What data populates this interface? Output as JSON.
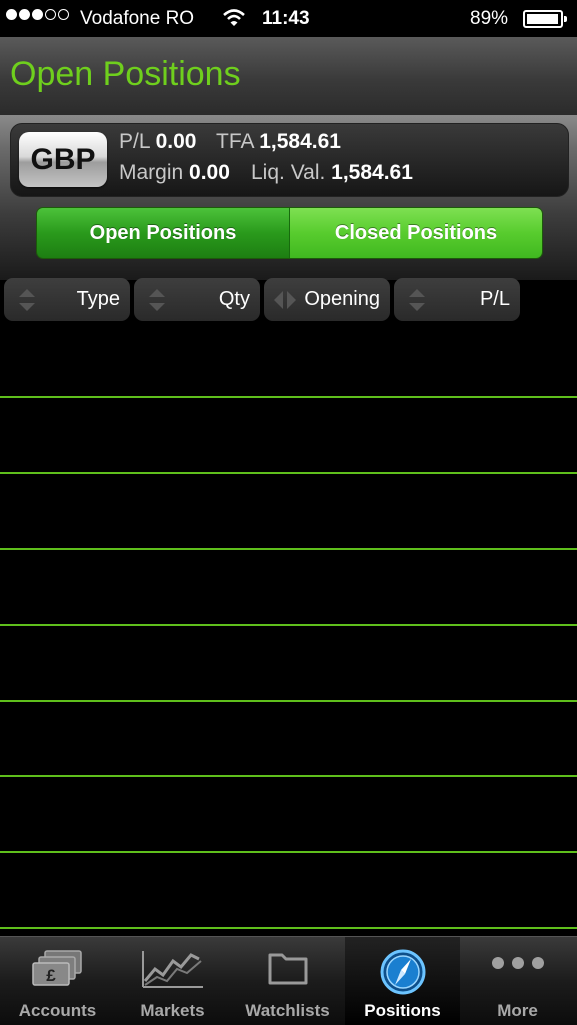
{
  "status_bar": {
    "carrier": "Vodafone RO",
    "time": "11:43",
    "battery": "89%",
    "signal_bars_filled": 3,
    "signal_bars_total": 5
  },
  "header": {
    "title": "Open Positions"
  },
  "account": {
    "currency": "GBP",
    "pl_label": "P/L",
    "pl_value": "0.00",
    "tfa_label": "TFA",
    "tfa_value": "1,584.61",
    "margin_label": "Margin",
    "margin_value": "0.00",
    "liq_label": "Liq. Val.",
    "liq_value": "1,584.61"
  },
  "segmented": {
    "open": "Open Positions",
    "closed": "Closed Positions"
  },
  "columns": [
    "Type",
    "Qty",
    "Opening",
    "P/L"
  ],
  "tab_bar": {
    "items": [
      "Accounts",
      "Markets",
      "Watchlists",
      "Positions",
      "More"
    ],
    "active": "Positions"
  },
  "colors": {
    "accent_green": "#6fcf1d",
    "grid_line": "#5fbf1c",
    "active_tab_icon": "#3fa9f5"
  }
}
